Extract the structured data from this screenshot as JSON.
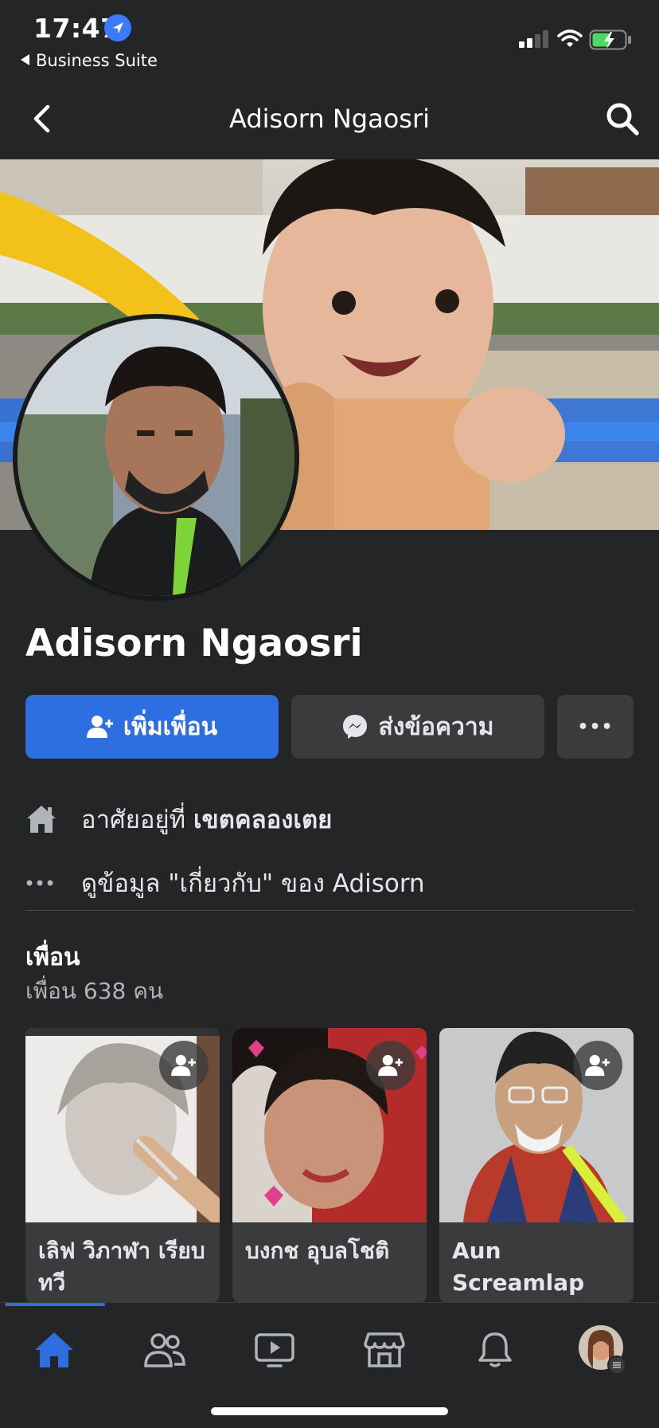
{
  "status_bar": {
    "time": "17:47",
    "back_app": "Business Suite",
    "icons": [
      "location-arrow-icon",
      "cellular-signal-icon",
      "wifi-icon",
      "battery-charging-icon"
    ]
  },
  "header": {
    "title": "Adisorn Ngaosri",
    "back_icon": "chevron-left-icon",
    "search_icon": "search-icon"
  },
  "profile": {
    "name": "Adisorn Ngaosri",
    "actions": {
      "add_friend": "เพิ่มเพื่อน",
      "message": "ส่งข้อความ",
      "more": "•••"
    },
    "lives_in_prefix": "อาศัยอยู่ที่ ",
    "lives_in_place": "เขตคลองเตย",
    "about_link": "ดูข้อมูล \"เกี่ยวกับ\" ของ Adisorn"
  },
  "friends": {
    "title": "เพื่อน",
    "count": "เพื่อน 638 คน",
    "items": [
      {
        "name": "เลิฟ วิภาฬา เรียบทวี"
      },
      {
        "name": "บงกช อุบลโชติ"
      },
      {
        "name": "Aun Screamlap"
      }
    ]
  },
  "bottom_nav": {
    "tabs": [
      "home-icon",
      "friends-icon",
      "watch-icon",
      "marketplace-icon",
      "notifications-icon",
      "profile-menu-avatar"
    ],
    "active": "home-icon"
  },
  "colors": {
    "background": "#242526",
    "accent": "#2d6fe0",
    "button_secondary": "#3a3b3c",
    "text_primary": "#e4e6eb",
    "text_secondary": "#b0b3b8"
  }
}
